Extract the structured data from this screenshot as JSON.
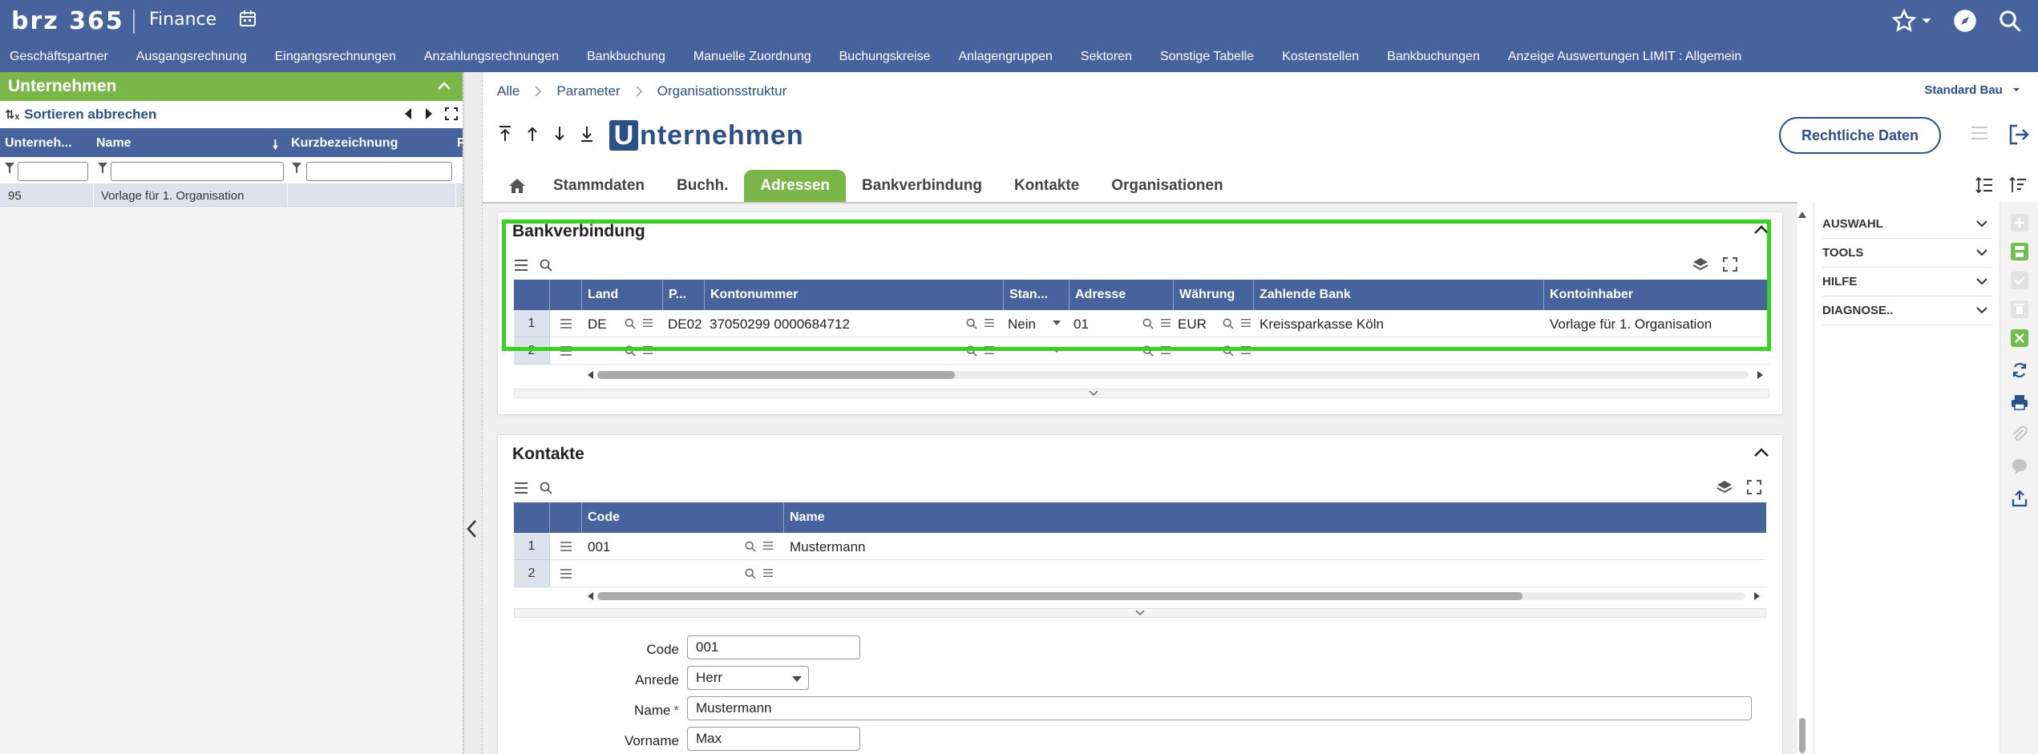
{
  "header": {
    "logo_text": "brz 365",
    "product": "Finance"
  },
  "nav": {
    "items": [
      "Geschäftspartner",
      "Ausgangsrechnung",
      "Eingangsrechnungen",
      "Anzahlungsrechnungen",
      "Bankbuchung",
      "Manuelle Zuordnung",
      "Buchungskreise",
      "Anlagengruppen",
      "Sektoren",
      "Sonstige Tabelle",
      "Kostenstellen",
      "Bankbuchungen",
      "Anzeige Auswertungen LIMIT : Allgemein"
    ]
  },
  "left_panel": {
    "title": "Unternehmen",
    "sort_label": "Sortieren abbrechen",
    "columns": [
      "Unterneh...",
      "Name",
      "Kurzbezeichnung",
      "F"
    ],
    "rows": [
      {
        "id": "95",
        "name": "Vorlage für 1. Organisation",
        "short": ""
      }
    ]
  },
  "breadcrumb": [
    "Alle",
    "Parameter",
    "Organisationsstruktur"
  ],
  "company_selector": "Standard Bau",
  "page_title_first": "U",
  "page_title_rest": "nternehmen",
  "rechtliche_daten_label": "Rechtliche Daten",
  "tabs": [
    "Stammdaten",
    "Buchh.",
    "Adressen",
    "Bankverbindung",
    "Kontakte",
    "Organisationen"
  ],
  "active_tab": "Adressen",
  "bank_panel": {
    "title": "Bankverbindung",
    "columns": [
      "Land",
      "P...",
      "Kontonummer",
      "Stan...",
      "Adresse",
      "Währung",
      "Zahlende Bank",
      "Kontoinhaber"
    ],
    "rows": [
      {
        "num": "1",
        "land": "DE",
        "p": "DE02",
        "konto": "37050299 0000684712",
        "stan": "Nein",
        "adresse": "01",
        "waehrung": "EUR",
        "bank": "Kreissparkasse Köln",
        "inhaber": "Vorlage für 1. Organisation"
      },
      {
        "num": "2"
      }
    ]
  },
  "contacts_panel": {
    "title": "Kontakte",
    "columns": [
      "Code",
      "Name"
    ],
    "rows": [
      {
        "num": "1",
        "code": "001",
        "name": "Mustermann"
      },
      {
        "num": "2"
      }
    ],
    "form": {
      "code_label": "Code",
      "code_value": "001",
      "anrede_label": "Anrede",
      "anrede_value": "Herr",
      "name_label": "Name",
      "name_required": "*",
      "name_value": "Mustermann",
      "vorname_label": "Vorname",
      "vorname_value": "Max"
    }
  },
  "right_panel": {
    "items": [
      "AUSWAHL",
      "TOOLS",
      "HILFE",
      "DIAGNOSE.."
    ]
  },
  "colors": {
    "header_blue": "#47639e",
    "accent_green": "#7ab648",
    "highlight_green": "#35d41f",
    "link_blue": "#2a4f8a"
  }
}
